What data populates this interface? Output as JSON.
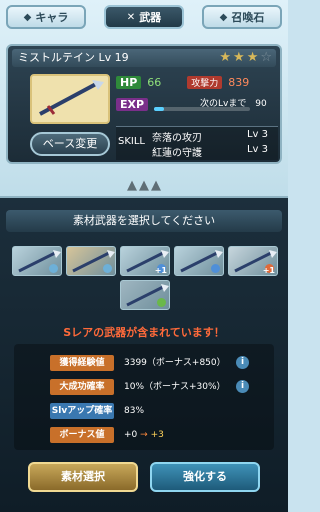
{
  "tabs": [
    {
      "label": "キャラ",
      "icon": "character-icon"
    },
    {
      "label": "武器",
      "icon": "swords-icon"
    },
    {
      "label": "召喚石",
      "icon": "summon-stone-icon"
    }
  ],
  "weapon": {
    "name": "ミストルテイン Lv 19",
    "rarity_stars_filled": 3,
    "rarity_stars_total": 4,
    "hp_label": "HP",
    "hp": "66",
    "atk_label": "攻撃力",
    "atk": "839",
    "exp_label": "EXP",
    "next_label": "次のLvまで",
    "next_value": "90",
    "base_change_label": "ベース変更",
    "skill_label": "SKILL",
    "skills": [
      {
        "name": "奈落の攻刃",
        "level": "Lv 3"
      },
      {
        "name": "紅蓮の守護",
        "level": "Lv 3"
      }
    ]
  },
  "materials": {
    "title": "素材武器を選択してください",
    "slots": [
      {
        "tint": "#b9d2dc",
        "gem": "#6db0d8"
      },
      {
        "tint": "#d7c59a",
        "gem": "#6db0d8"
      },
      {
        "tint": "#b9d2dc",
        "gem": "#4f8fd8",
        "plus": "+1"
      },
      {
        "tint": "#b9d2dc",
        "gem": "#4f8fd8"
      },
      {
        "tint": "#c7d6dd",
        "gem": "#e06a3a",
        "plus": "+1"
      },
      {
        "tint": "#9fb6c1",
        "gem": "#6ab84a"
      }
    ],
    "warning": "Sレアの武器が含まれています！"
  },
  "info": {
    "rows": [
      {
        "label": "獲得経験値",
        "value": "3399（ボーナス+850）",
        "color": "#c8702a",
        "has_icon": true
      },
      {
        "label": "大成功確率",
        "value": "10%（ボーナス+30%）",
        "color": "#c8702a",
        "has_icon": true
      },
      {
        "label": "Slvアップ確率",
        "value": "83%",
        "color": "#3a78b0",
        "has_icon": false
      },
      {
        "label": "ボーナス値",
        "value_before": "+0",
        "value_arrow": "→",
        "value_after": "+3",
        "color": "#c8702a",
        "has_icon": false
      }
    ]
  },
  "buttons": {
    "material_select": "素材選択",
    "upgrade": "強化する"
  }
}
